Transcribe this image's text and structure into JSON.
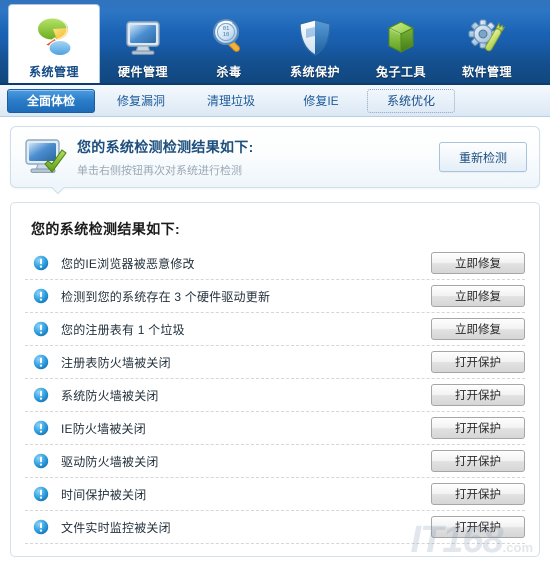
{
  "toolbar": {
    "items": [
      {
        "label": "系统管理",
        "icon": "pie-chart-icon",
        "active": true
      },
      {
        "label": "硬件管理",
        "icon": "monitor-icon",
        "active": false
      },
      {
        "label": "杀毒",
        "icon": "magnifier-icon",
        "active": false
      },
      {
        "label": "系统保护",
        "icon": "shield-icon",
        "active": false
      },
      {
        "label": "兔子工具",
        "icon": "green-box-icon",
        "active": false
      },
      {
        "label": "软件管理",
        "icon": "gear-wrench-icon",
        "active": false
      }
    ]
  },
  "tabs": [
    {
      "label": "全面体检",
      "state": "active"
    },
    {
      "label": "修复漏洞",
      "state": "normal"
    },
    {
      "label": "清理垃圾",
      "state": "normal"
    },
    {
      "label": "修复IE",
      "state": "normal"
    },
    {
      "label": "系统优化",
      "state": "focusring"
    }
  ],
  "banner": {
    "icon": "monitor-check-icon",
    "title": "您的系统检测检测结果如下:",
    "subtitle": "单击右侧按钮再次对系统进行检测",
    "button_label": "重新检测"
  },
  "results": {
    "title": "您的系统检测结果如下:",
    "rows": [
      {
        "icon": "warning-icon",
        "label": "您的IE浏览器被恶意修改",
        "button": "立即修复"
      },
      {
        "icon": "warning-icon",
        "label": "检测到您的系统存在 3 个硬件驱动更新",
        "button": "立即修复"
      },
      {
        "icon": "warning-icon",
        "label": "您的注册表有 1 个垃圾",
        "button": "立即修复"
      },
      {
        "icon": "warning-icon",
        "label": "注册表防火墙被关闭",
        "button": "打开保护"
      },
      {
        "icon": "warning-icon",
        "label": "系统防火墙被关闭",
        "button": "打开保护"
      },
      {
        "icon": "warning-icon",
        "label": "IE防火墙被关闭",
        "button": "打开保护"
      },
      {
        "icon": "warning-icon",
        "label": "驱动防火墙被关闭",
        "button": "打开保护"
      },
      {
        "icon": "warning-icon",
        "label": "时间保护被关闭",
        "button": "打开保护"
      },
      {
        "icon": "warning-icon",
        "label": "文件实时监控被关闭",
        "button": "打开保护"
      }
    ]
  },
  "watermark": {
    "text": "IT168",
    "domain": ".com"
  },
  "colors": {
    "toolbar_blue": "#1a5fb0",
    "tab_active_blue": "#2a7bc8",
    "accent_title": "#1e4f7e",
    "warning_blue": "#2d9ee0"
  }
}
